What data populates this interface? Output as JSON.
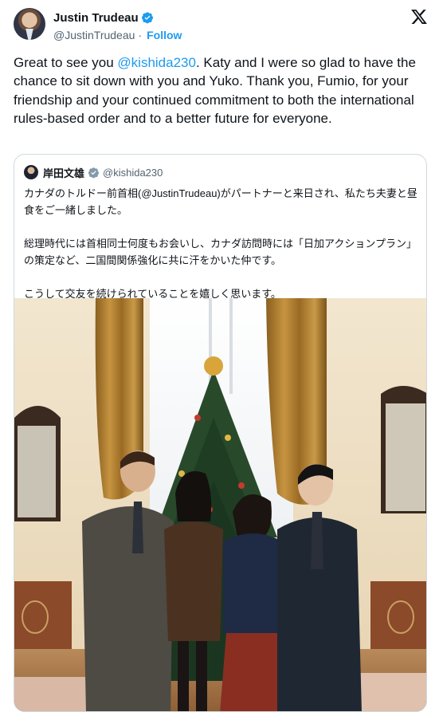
{
  "author": {
    "display_name": "Justin Trudeau",
    "handle": "@JustinTrudeau",
    "separator": "·",
    "follow_label": "Follow"
  },
  "tweet": {
    "text_before": "Great to see you ",
    "mention": "@kishida230",
    "text_after": ". Katy and I were so glad to have the chance to sit down with you and Yuko. Thank you, Fumio, for your friendship and your continued commitment to both the international rules-based order and to a better future for everyone."
  },
  "quoted": {
    "display_name": "岸田文雄",
    "handle": "@kishida230",
    "paragraphs": [
      "カナダのトルドー前首相(@JustinTrudeau)がパートナーと来日され、私たち夫妻と昼食をご一緒しました。",
      "総理時代には首相同士何度もお会いし、カナダ訪問時には「日加アクションプラン」の策定など、二国間関係強化に共に汗をかいた仲です。",
      "こうして交友を続けられていることを嬉しく思います。"
    ]
  },
  "icons": {
    "verified": "verified-badge-icon",
    "brand": "x-logo-icon"
  },
  "colors": {
    "link": "#1d9bf0",
    "secondary_text": "#536471",
    "border": "#cfd9de"
  }
}
